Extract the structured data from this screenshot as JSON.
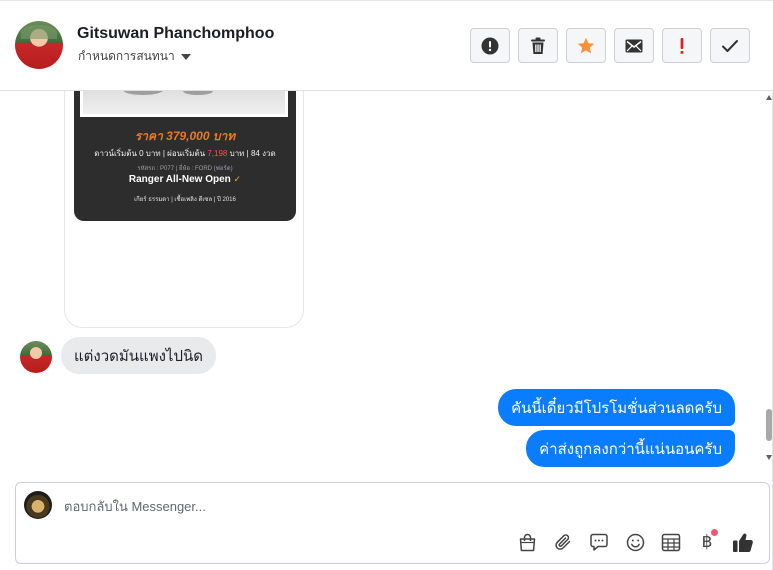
{
  "header": {
    "contact_name": "Gitsuwan Phanchomphoo",
    "label_dropdown": "กำหนดการสนทนา",
    "actions": [
      {
        "name": "spam-button",
        "icon": "alert-circle-icon"
      },
      {
        "name": "delete-button",
        "icon": "trash-icon"
      },
      {
        "name": "star-button",
        "icon": "star-icon"
      },
      {
        "name": "mark-unread-button",
        "icon": "envelope-icon"
      },
      {
        "name": "follow-up-button",
        "icon": "exclamation-icon"
      },
      {
        "name": "done-button",
        "icon": "check-icon"
      }
    ],
    "star_color": "#f7923a",
    "follow_up_color": "#e02020"
  },
  "conversation": {
    "ad": {
      "price": "ราคา 379,000 บาท",
      "terms_a": "ดาวน์เริ่มต้น 0 บาท | ผ่อนเริ่มต้น",
      "terms_price": "7,198",
      "terms_b": "บาท | 84 งวด",
      "meta": "รหัสรถ : P077 | ยี่ห้อ : FORD (ฟอร์ด)",
      "model": "Ranger All-New Open",
      "specs": "เกียร์ ธรรมดา   |   เชื้อเพลิง ดีเซล   |   ปี 2016"
    },
    "incoming": "แต่งวดมันแพงไปนิด",
    "outgoing": [
      "คันนี้เดี๋ยวมีโปรโมชั่นส่วนลดครับ",
      "ค่าส่งถูกลงกว่านี้แน่นอนครับ"
    ],
    "outgoing_color": "#0a7cff"
  },
  "composer": {
    "placeholder": "ตอบกลับใน Messenger...",
    "tools": [
      "shopping-bag-icon",
      "paperclip-icon",
      "saved-reply-icon",
      "emoji-icon",
      "appointment-icon",
      "payment-icon",
      "like-icon"
    ],
    "payment_symbol": "฿"
  }
}
